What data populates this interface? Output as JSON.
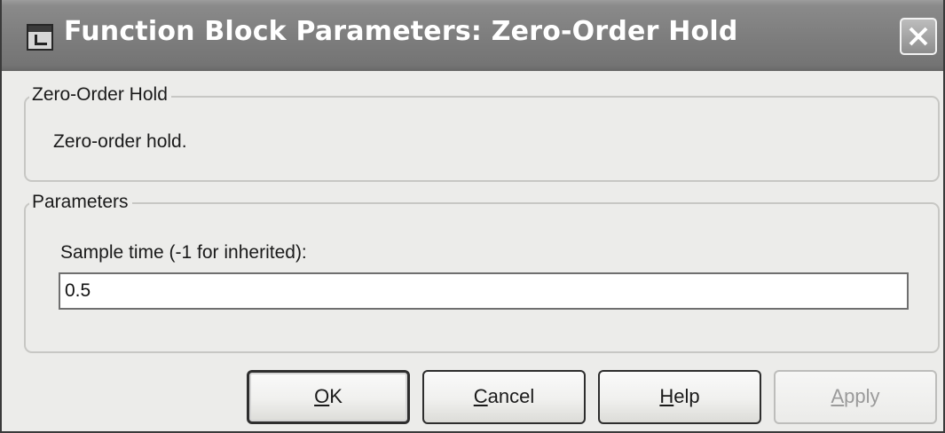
{
  "window": {
    "title": "Function Block Parameters: Zero-Order Hold"
  },
  "description_group": {
    "legend": "Zero-Order Hold",
    "text": "Zero-order hold."
  },
  "parameters_group": {
    "legend": "Parameters",
    "sample_time_label": "Sample time (-1 for inherited):",
    "sample_time_value": "0.5"
  },
  "buttons": {
    "ok": {
      "mnemonic": "O",
      "rest": "K"
    },
    "cancel": {
      "mnemonic": "C",
      "rest": "ancel"
    },
    "help": {
      "mnemonic": "H",
      "rest": "elp"
    },
    "apply": {
      "mnemonic": "A",
      "rest": "pply",
      "disabled": true
    }
  },
  "icons": {
    "title": "block-parameters-icon",
    "close": "close-icon"
  }
}
